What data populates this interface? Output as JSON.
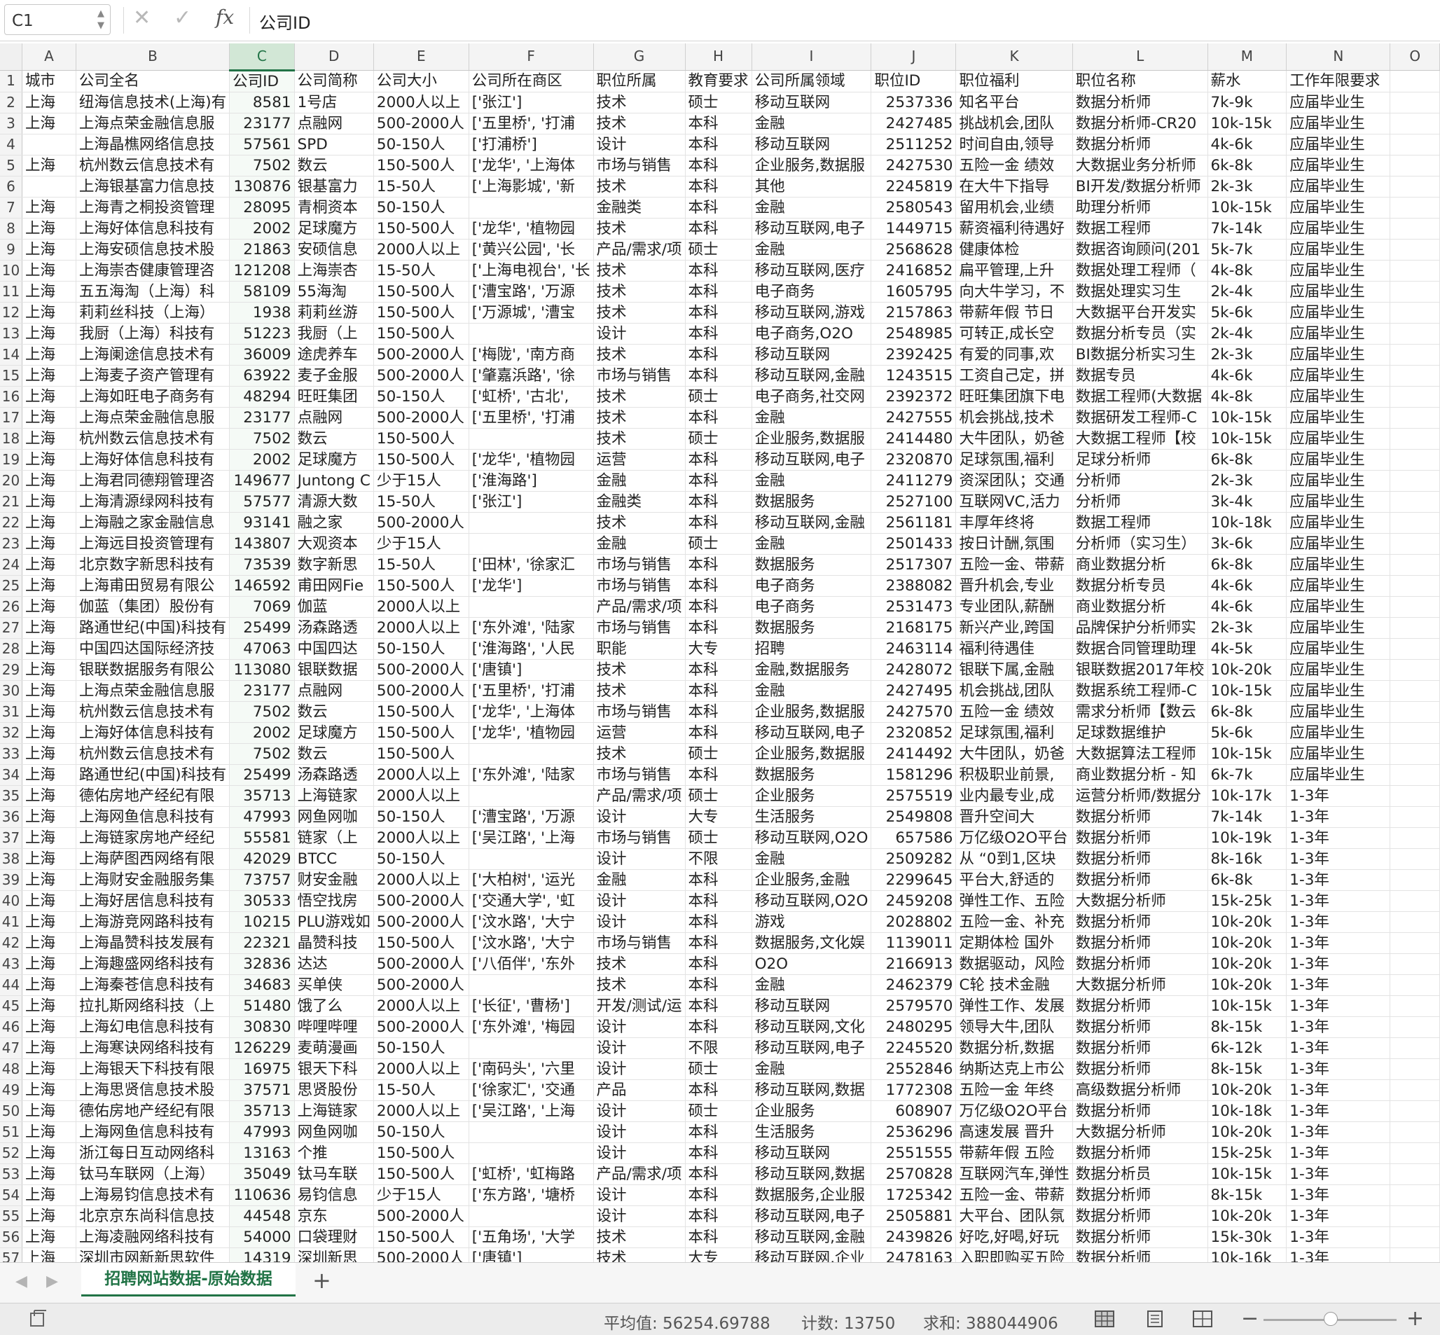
{
  "formula_bar": {
    "cell_ref": "C1",
    "content": "公司ID"
  },
  "columns": [
    "A",
    "B",
    "C",
    "D",
    "E",
    "F",
    "G",
    "H",
    "I",
    "J",
    "K",
    "L",
    "M",
    "N",
    "O"
  ],
  "selected_column": "C",
  "rows": [
    [
      "城市",
      "公司全名",
      "公司ID",
      "公司简称",
      "公司大小",
      "公司所在商区",
      "职位所属",
      "教育要求",
      "公司所属领域",
      "职位ID",
      "职位福利",
      "职位名称",
      "薪水",
      "工作年限要求"
    ],
    [
      "上海",
      "纽海信息技术(上海)有",
      "8581",
      "1号店",
      "2000人以上",
      "['张江']",
      "技术",
      "硕士",
      "移动互联网",
      "2537336",
      "知名平台",
      "数据分析师",
      "7k-9k",
      "应届毕业生"
    ],
    [
      "上海",
      "上海点荣金融信息服",
      "23177",
      "点融网",
      "500-2000人",
      "['五里桥', '打浦",
      "技术",
      "本科",
      "金融",
      "2427485",
      "挑战机会,团队",
      "数据分析师-CR20",
      "10k-15k",
      "应届毕业生"
    ],
    [
      "",
      "上海晶樵网络信息技",
      "57561",
      "SPD",
      "50-150人",
      "['打浦桥']",
      "设计",
      "本科",
      "移动互联网",
      "2511252",
      "时间自由,领导",
      "数据分析师",
      "4k-6k",
      "应届毕业生"
    ],
    [
      "上海",
      "杭州数云信息技术有",
      "7502",
      "数云",
      "150-500人",
      "['龙华', '上海体",
      "市场与销售",
      "本科",
      "企业服务,数据服",
      "2427530",
      "五险一金 绩效",
      "大数据业务分析师",
      "6k-8k",
      "应届毕业生"
    ],
    [
      "",
      "上海银基富力信息技",
      "130876",
      "银基富力",
      "15-50人",
      "['上海影城', '新",
      "技术",
      "本科",
      "其他",
      "2245819",
      "在大牛下指导",
      "BI开发/数据分析师",
      "2k-3k",
      "应届毕业生"
    ],
    [
      "上海",
      "上海青之桐投资管理",
      "28095",
      "青桐资本",
      "50-150人",
      "",
      "金融类",
      "本科",
      "金融",
      "2580543",
      "留用机会,业绩",
      "助理分析师",
      "10k-15k",
      "应届毕业生"
    ],
    [
      "上海",
      "上海好体信息科技有",
      "2002",
      "足球魔方",
      "150-500人",
      "['龙华', '植物园",
      "技术",
      "本科",
      "移动互联网,电子",
      "1449715",
      "薪资福利待遇好",
      "数据工程师",
      "7k-14k",
      "应届毕业生"
    ],
    [
      "上海",
      "上海安硕信息技术股",
      "21863",
      "安硕信息",
      "2000人以上",
      "['黄兴公园', '长",
      "产品/需求/项",
      "硕士",
      "金融",
      "2568628",
      "健康体检",
      "数据咨询顾问(201",
      "5k-7k",
      "应届毕业生"
    ],
    [
      "上海",
      "上海崇杏健康管理咨",
      "121208",
      "上海崇杏",
      "15-50人",
      "['上海电视台', '长",
      "技术",
      "本科",
      "移动互联网,医疗",
      "2416852",
      "扁平管理,上升",
      "数据处理工程师（",
      "4k-8k",
      "应届毕业生"
    ],
    [
      "上海",
      "五五海淘（上海）科",
      "58109",
      "55海淘",
      "150-500人",
      "['漕宝路', '万源",
      "技术",
      "本科",
      "电子商务",
      "1605795",
      "向大牛学习，不",
      "数据处理实习生",
      "2k-4k",
      "应届毕业生"
    ],
    [
      "上海",
      "莉莉丝科技（上海）",
      "1938",
      "莉莉丝游",
      "150-500人",
      "['万源城', '漕宝",
      "技术",
      "本科",
      "移动互联网,游戏",
      "2157863",
      "带薪年假 节日",
      "大数据平台开发实",
      "5k-6k",
      "应届毕业生"
    ],
    [
      "上海",
      "我厨（上海）科技有",
      "51223",
      "我厨（上",
      "150-500人",
      "",
      "设计",
      "本科",
      "电子商务,O2O",
      "2548985",
      "可转正,成长空",
      "数据分析专员（实",
      "2k-4k",
      "应届毕业生"
    ],
    [
      "上海",
      "上海阑途信息技术有",
      "36009",
      "途虎养车",
      "500-2000人",
      "['梅陇', '南方商",
      "技术",
      "本科",
      "移动互联网",
      "2392425",
      "有爱的同事,欢",
      "BI数据分析实习生",
      "2k-3k",
      "应届毕业生"
    ],
    [
      "上海",
      "上海麦子资产管理有",
      "63922",
      "麦子金服",
      "500-2000人",
      "['肇嘉浜路', '徐",
      "市场与销售",
      "本科",
      "移动互联网,金融",
      "1243515",
      "工资自己定，拼",
      "数据专员",
      "4k-6k",
      "应届毕业生"
    ],
    [
      "上海",
      "上海如旺电子商务有",
      "48294",
      "旺旺集团",
      "50-150人",
      "['虹桥', '古北',",
      "技术",
      "硕士",
      "电子商务,社交网",
      "2392372",
      "旺旺集团旗下电",
      "数据工程师(大数据",
      "4k-8k",
      "应届毕业生"
    ],
    [
      "上海",
      "上海点荣金融信息服",
      "23177",
      "点融网",
      "500-2000人",
      "['五里桥', '打浦",
      "技术",
      "本科",
      "金融",
      "2427555",
      "机会挑战,技术",
      "数据研发工程师-C",
      "10k-15k",
      "应届毕业生"
    ],
    [
      "上海",
      "杭州数云信息技术有",
      "7502",
      "数云",
      "150-500人",
      "",
      "技术",
      "硕士",
      "企业服务,数据服",
      "2414480",
      "大牛团队，奶爸",
      "大数据工程师【校",
      "10k-15k",
      "应届毕业生"
    ],
    [
      "上海",
      "上海好体信息科技有",
      "2002",
      "足球魔方",
      "150-500人",
      "['龙华', '植物园",
      "运营",
      "本科",
      "移动互联网,电子",
      "2320870",
      "足球氛围,福利",
      "足球分析师",
      "6k-8k",
      "应届毕业生"
    ],
    [
      "上海",
      "上海君同德翔管理咨",
      "149677",
      "Juntong C",
      "少于15人",
      "['淮海路']",
      "金融",
      "本科",
      "金融",
      "2411279",
      "资深团队；交通",
      "分析师",
      "2k-3k",
      "应届毕业生"
    ],
    [
      "上海",
      "上海清源绿网科技有",
      "57577",
      "清源大数",
      "15-50人",
      "['张江']",
      "金融类",
      "本科",
      "数据服务",
      "2527100",
      "互联网VC,活力",
      "分析师",
      "3k-4k",
      "应届毕业生"
    ],
    [
      "上海",
      "上海融之家金融信息",
      "93141",
      "融之家",
      "500-2000人",
      "",
      "技术",
      "本科",
      "移动互联网,金融",
      "2561181",
      "丰厚年终将",
      "数据工程师",
      "10k-18k",
      "应届毕业生"
    ],
    [
      "上海",
      "上海远目投资管理有",
      "143807",
      "大观资本",
      "少于15人",
      "",
      "金融",
      "硕士",
      "金融",
      "2501433",
      "按日计酬,氛围",
      "分析师（实习生）",
      "3k-6k",
      "应届毕业生"
    ],
    [
      "上海",
      "北京数字新思科技有",
      "73539",
      "数字新思",
      "15-50人",
      "['田林', '徐家汇",
      "市场与销售",
      "本科",
      "数据服务",
      "2517307",
      "五险一金、带薪",
      "商业数据分析",
      "6k-8k",
      "应届毕业生"
    ],
    [
      "上海",
      "上海甫田贸易有限公",
      "146592",
      "甫田网Fie",
      "150-500人",
      "['龙华']",
      "市场与销售",
      "本科",
      "电子商务",
      "2388082",
      "晋升机会,专业",
      "数据分析专员",
      "4k-6k",
      "应届毕业生"
    ],
    [
      "上海",
      "伽蓝（集团）股份有",
      "7069",
      "伽蓝",
      "2000人以上",
      "",
      "产品/需求/项",
      "本科",
      "电子商务",
      "2531473",
      "专业团队,薪酬",
      "商业数据分析",
      "4k-6k",
      "应届毕业生"
    ],
    [
      "上海",
      "路通世纪(中国)科技有",
      "25499",
      "汤森路透",
      "2000人以上",
      "['东外滩', '陆家",
      "市场与销售",
      "本科",
      "数据服务",
      "2168175",
      "新兴产业,跨国",
      "品牌保护分析师实",
      "2k-3k",
      "应届毕业生"
    ],
    [
      "上海",
      "中国四达国际经济技",
      "47063",
      "中国四达",
      "50-150人",
      "['淮海路', '人民",
      "职能",
      "大专",
      "招聘",
      "2463114",
      "福利待遇佳",
      "数据合同管理助理",
      "4k-5k",
      "应届毕业生"
    ],
    [
      "上海",
      "银联数据服务有限公",
      "113080",
      "银联数据",
      "500-2000人",
      "['唐镇']",
      "技术",
      "本科",
      "金融,数据服务",
      "2428072",
      "银联下属,金融",
      "银联数据2017年校",
      "10k-20k",
      "应届毕业生"
    ],
    [
      "上海",
      "上海点荣金融信息服",
      "23177",
      "点融网",
      "500-2000人",
      "['五里桥', '打浦",
      "技术",
      "本科",
      "金融",
      "2427495",
      "机会挑战,团队",
      "数据系统工程师-C",
      "10k-15k",
      "应届毕业生"
    ],
    [
      "上海",
      "杭州数云信息技术有",
      "7502",
      "数云",
      "150-500人",
      "['龙华', '上海体",
      "市场与销售",
      "本科",
      "企业服务,数据服",
      "2427570",
      "五险一金 绩效",
      "需求分析师【数云",
      "6k-8k",
      "应届毕业生"
    ],
    [
      "上海",
      "上海好体信息科技有",
      "2002",
      "足球魔方",
      "150-500人",
      "['龙华', '植物园",
      "运营",
      "本科",
      "移动互联网,电子",
      "2320852",
      "足球氛围,福利",
      "足球数据维护",
      "5k-6k",
      "应届毕业生"
    ],
    [
      "上海",
      "杭州数云信息技术有",
      "7502",
      "数云",
      "150-500人",
      "",
      "技术",
      "硕士",
      "企业服务,数据服",
      "2414492",
      "大牛团队，奶爸",
      "大数据算法工程师",
      "10k-15k",
      "应届毕业生"
    ],
    [
      "上海",
      "路通世纪(中国)科技有",
      "25499",
      "汤森路透",
      "2000人以上",
      "['东外滩', '陆家",
      "市场与销售",
      "本科",
      "数据服务",
      "1581296",
      "积极职业前景,",
      "商业数据分析 - 知",
      "6k-7k",
      "应届毕业生"
    ],
    [
      "上海",
      "德佑房地产经纪有限",
      "35713",
      "上海链家",
      "2000人以上",
      "",
      "产品/需求/项",
      "硕士",
      "企业服务",
      "2575519",
      "业内最专业,成",
      "运营分析师/数据分",
      "10k-17k",
      "1-3年"
    ],
    [
      "上海",
      "上海网鱼信息科技有",
      "47993",
      "网鱼网咖",
      "50-150人",
      "['漕宝路', '万源",
      "设计",
      "大专",
      "生活服务",
      "2549808",
      "晋升空间大",
      "数据分析师",
      "7k-14k",
      "1-3年"
    ],
    [
      "上海",
      "上海链家房地产经纪",
      "55581",
      "链家（上",
      "2000人以上",
      "['吴江路', '上海",
      "市场与销售",
      "硕士",
      "移动互联网,O2O",
      "657586",
      "万亿级O2O平台",
      "数据分析师",
      "10k-19k",
      "1-3年"
    ],
    [
      "上海",
      "上海萨图西网络有限",
      "42029",
      "BTCC",
      "50-150人",
      "",
      "设计",
      "不限",
      "金融",
      "2509282",
      "从 “0到1,区块",
      "数据分析师",
      "8k-16k",
      "1-3年"
    ],
    [
      "上海",
      "上海财安金融服务集",
      "73757",
      "财安金融",
      "2000人以上",
      "['大柏树', '运光",
      "金融",
      "本科",
      "企业服务,金融",
      "2299645",
      "平台大,舒适的",
      "数据分析师",
      "6k-8k",
      "1-3年"
    ],
    [
      "上海",
      "上海好居信息科技有",
      "30533",
      "悟空找房",
      "500-2000人",
      "['交通大学', '虹",
      "设计",
      "本科",
      "移动互联网,O2O",
      "2459208",
      "弹性工作、五险",
      "大数据分析师",
      "15k-25k",
      "1-3年"
    ],
    [
      "上海",
      "上海游竞网路科技有",
      "10215",
      "PLU游戏如",
      "500-2000人",
      "['汶水路', '大宁",
      "设计",
      "本科",
      "游戏",
      "2028802",
      "五险一金、补充",
      "数据分析师",
      "10k-20k",
      "1-3年"
    ],
    [
      "上海",
      "上海晶赞科技发展有",
      "22321",
      "晶赞科技",
      "150-500人",
      "['汶水路', '大宁",
      "市场与销售",
      "本科",
      "数据服务,文化娱",
      "1139011",
      "定期体检 国外",
      "数据分析师",
      "10k-20k",
      "1-3年"
    ],
    [
      "上海",
      "上海趣盛网络科技有",
      "32836",
      "达达",
      "500-2000人",
      "['八佰伴', '东外",
      "技术",
      "本科",
      "O2O",
      "2166913",
      "数据驱动，风险",
      "数据分析师",
      "10k-20k",
      "1-3年"
    ],
    [
      "上海",
      "上海秦苍信息科技有",
      "34683",
      "买单侠",
      "500-2000人",
      "",
      "技术",
      "本科",
      "金融",
      "2462379",
      "C轮 技术金融",
      "大数据分析师",
      "10k-20k",
      "1-3年"
    ],
    [
      "上海",
      "拉扎斯网络科技（上",
      "51480",
      "饿了么",
      "2000人以上",
      "['长征', '曹杨']",
      "开发/测试/运",
      "本科",
      "移动互联网",
      "2579570",
      "弹性工作、发展",
      "数据分析师",
      "10k-15k",
      "1-3年"
    ],
    [
      "上海",
      "上海幻电信息科技有",
      "30830",
      "哔哩哔哩",
      "500-2000人",
      "['东外滩', '梅园",
      "设计",
      "本科",
      "移动互联网,文化",
      "2480295",
      "领导大牛,团队",
      "数据分析师",
      "8k-15k",
      "1-3年"
    ],
    [
      "上海",
      "上海寒诀网络科技有",
      "126229",
      "麦萌漫画",
      "50-150人",
      "",
      "设计",
      "不限",
      "移动互联网,电子",
      "2245520",
      "数据分析,数据",
      "数据分析师",
      "6k-12k",
      "1-3年"
    ],
    [
      "上海",
      "上海银天下科技有限",
      "16975",
      "银天下科",
      "2000人以上",
      "['南码头', '六里",
      "设计",
      "硕士",
      "金融",
      "2552846",
      "纳斯达克上市公",
      "数据分析师",
      "8k-15k",
      "1-3年"
    ],
    [
      "上海",
      "上海思贤信息技术股",
      "37571",
      "思贤股份",
      "15-50人",
      "['徐家汇', '交通",
      "产品",
      "本科",
      "移动互联网,数据",
      "1772308",
      "五险一金 年终",
      "高级数据分析师",
      "10k-20k",
      "1-3年"
    ],
    [
      "上海",
      "德佑房地产经纪有限",
      "35713",
      "上海链家",
      "2000人以上",
      "['吴江路', '上海",
      "设计",
      "硕士",
      "企业服务",
      "608907",
      "万亿级O2O平台",
      "数据分析师",
      "10k-18k",
      "1-3年"
    ],
    [
      "上海",
      "上海网鱼信息科技有",
      "47993",
      "网鱼网咖",
      "50-150人",
      "",
      "设计",
      "本科",
      "生活服务",
      "2536296",
      "高速发展 晋升",
      "大数据分析师",
      "10k-20k",
      "1-3年"
    ],
    [
      "上海",
      "浙江每日互动网络科",
      "13163",
      "个推",
      "150-500人",
      "",
      "设计",
      "本科",
      "移动互联网",
      "2551555",
      "带薪年假 五险",
      "数据分析师",
      "15k-25k",
      "1-3年"
    ],
    [
      "上海",
      "钛马车联网（上海）",
      "35049",
      "钛马车联",
      "150-500人",
      "['虹桥', '虹梅路",
      "产品/需求/项",
      "本科",
      "移动互联网,数据",
      "2570828",
      "互联网汽车,弹性",
      "数据分析员",
      "10k-15k",
      "1-3年"
    ],
    [
      "上海",
      "上海易钧信息技术有",
      "110636",
      "易钧信息",
      "少于15人",
      "['东方路', '塘桥",
      "设计",
      "本科",
      "数据服务,企业服",
      "1725342",
      "五险一金、带薪",
      "数据分析师",
      "8k-15k",
      "1-3年"
    ],
    [
      "上海",
      "北京京东尚科信息技",
      "44548",
      "京东",
      "500-2000人",
      "",
      "设计",
      "本科",
      "移动互联网,电子",
      "2505881",
      "大平台、团队氛",
      "数据分析师",
      "10k-20k",
      "1-3年"
    ],
    [
      "上海",
      "上海凌融网络科技有",
      "54000",
      "口袋理财",
      "150-500人",
      "['五角场', '大学",
      "技术",
      "本科",
      "移动互联网,金融",
      "2439826",
      "好吃,好喝,好玩",
      "数据分析师",
      "15k-30k",
      "1-3年"
    ],
    [
      "上海",
      "深圳市网新新思软件",
      "14319",
      "深圳新思",
      "500-2000人",
      "['唐镇']",
      "技术",
      "大专",
      "移动互联网,企业",
      "2478163",
      "入职即购买五险",
      "数据分析师",
      "10k-16k",
      "1-3年"
    ]
  ],
  "sheet_tab": {
    "name": "招聘网站数据-原始数据",
    "add_label": "+"
  },
  "status_bar": {
    "average": "平均值: 56254.69788",
    "count": "计数: 13750",
    "sum": "求和: 388044906",
    "zoom_minus": "−",
    "zoom_plus": "+"
  },
  "icons": {
    "cancel": "✕",
    "confirm": "✓",
    "fx": "fx",
    "prev_sheet": "◀",
    "next_sheet": "▶"
  },
  "colors": {
    "accent": "#217346",
    "selected_header_bg": "#d2e7d6"
  }
}
